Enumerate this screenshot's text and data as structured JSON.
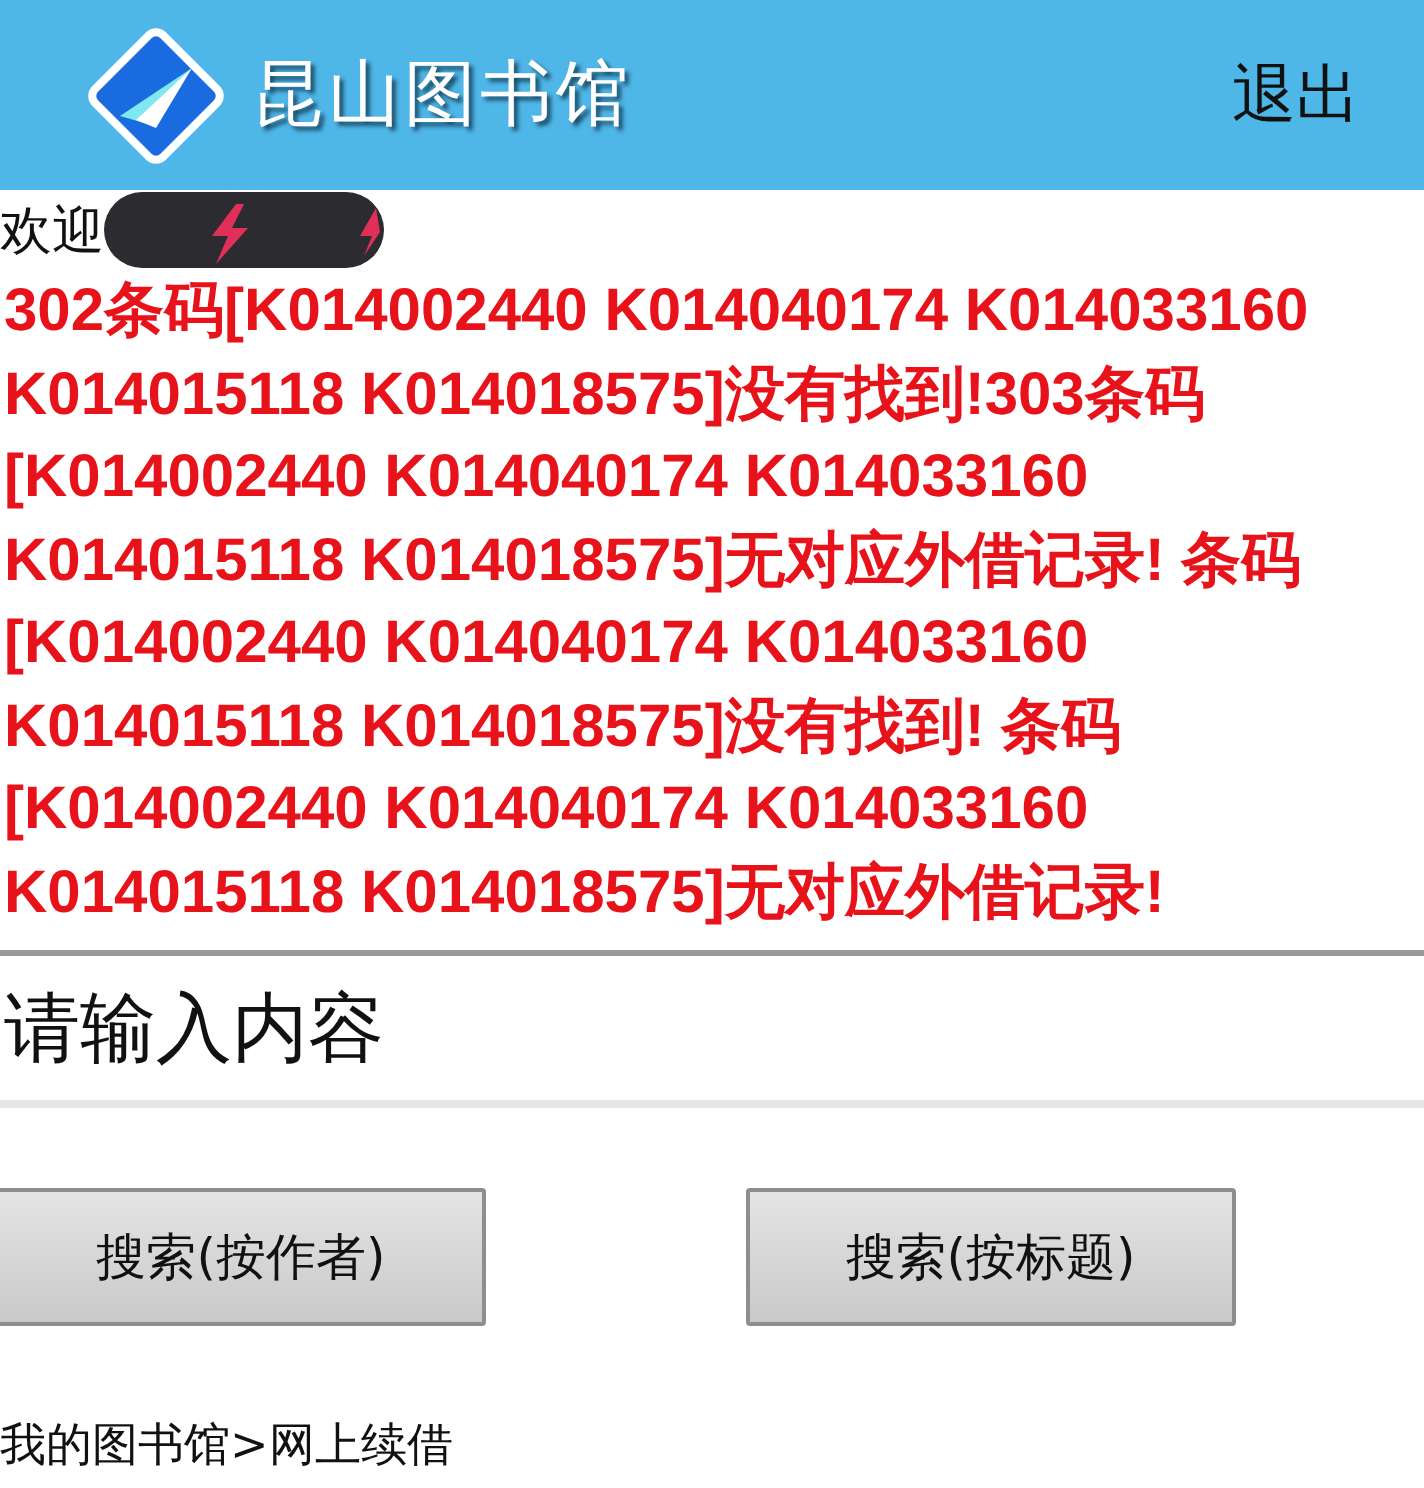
{
  "header": {
    "title": "昆山图书馆",
    "logout": "退出"
  },
  "welcome": "欢迎",
  "message": "302条码[K014002440 K014040174 K014033160 K014015118 K014018575]没有找到!303条码[K014002440 K014040174 K014033160 K014015118 K014018575]无对应外借记录! 条码[K014002440 K014040174 K014033160 K014015118 K014018575]没有找到! 条码[K014002440 K014040174 K014033160 K014015118 K014018575]无对应外借记录!",
  "search": {
    "placeholder": "请输入内容"
  },
  "buttons": [
    "搜索(按作者)",
    "搜索(按标题)"
  ],
  "breadcrumb": "我的图书馆>网上续借"
}
